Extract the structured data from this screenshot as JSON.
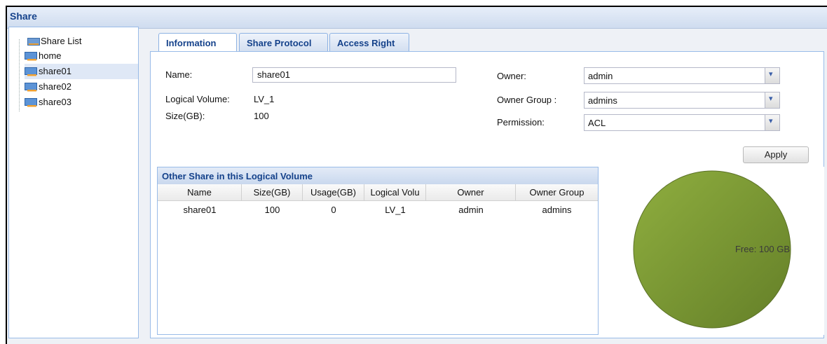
{
  "window": {
    "title": "Share"
  },
  "tree": {
    "root": "Share List",
    "items": [
      {
        "label": "home",
        "selected": false
      },
      {
        "label": "share01",
        "selected": true
      },
      {
        "label": "share02",
        "selected": false
      },
      {
        "label": "share03",
        "selected": false
      }
    ]
  },
  "tabs": [
    {
      "label": "Information",
      "active": true
    },
    {
      "label": "Share Protocol",
      "active": false
    },
    {
      "label": "Access Right",
      "active": false
    }
  ],
  "info": {
    "name_label": "Name:",
    "name_value": "share01",
    "lv_label": "Logical Volume:",
    "lv_value": "LV_1",
    "size_label": "Size(GB):",
    "size_value": "100",
    "owner_label": "Owner:",
    "owner_value": "admin",
    "owner_group_label": "Owner Group :",
    "owner_group_value": "admins",
    "permission_label": "Permission:",
    "permission_value": "ACL",
    "apply_label": "Apply"
  },
  "grid": {
    "title": "Other Share in this Logical Volume",
    "columns": [
      "Name",
      "Size(GB)",
      "Usage(GB)",
      "Logical Volu",
      "Owner",
      "Owner Group"
    ],
    "rows": [
      [
        "share01",
        "100",
        "0",
        "LV_1",
        "admin",
        "admins"
      ]
    ]
  },
  "chart_data": {
    "type": "pie",
    "slices": [
      {
        "label": "Free: 100 GB",
        "value": 100,
        "color": "#7a9a33"
      }
    ]
  },
  "colors": {
    "accent": "#15428b",
    "border": "#99bbe8",
    "pie": "#7a9a33"
  }
}
